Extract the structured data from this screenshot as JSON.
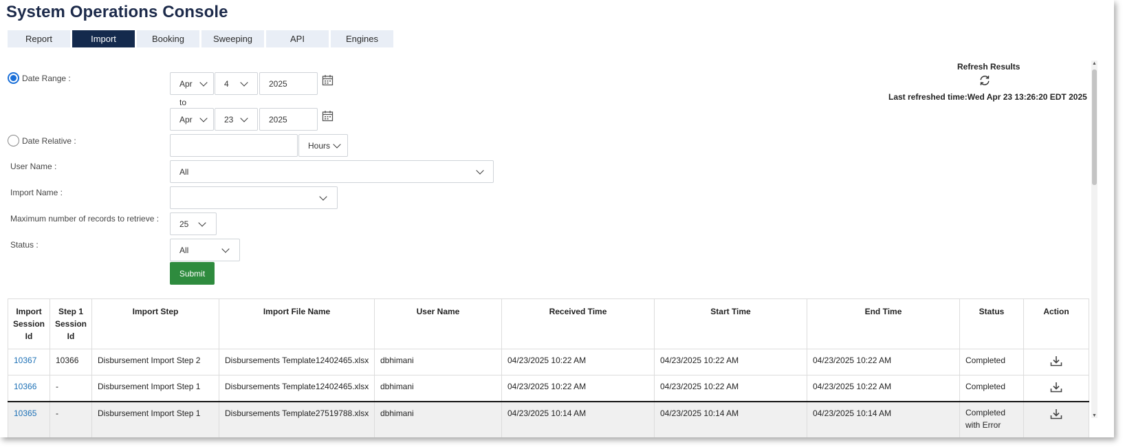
{
  "app": {
    "title": "System Operations Console"
  },
  "tabs": [
    {
      "label": "Report",
      "active": false
    },
    {
      "label": "Import",
      "active": true
    },
    {
      "label": "Booking",
      "active": false
    },
    {
      "label": "Sweeping",
      "active": false
    },
    {
      "label": "API",
      "active": false
    },
    {
      "label": "Engines",
      "active": false
    }
  ],
  "filters": {
    "date_range": {
      "label": "Date Range :",
      "selected": true,
      "from": {
        "month": "Apr",
        "day": "4",
        "year": "2025"
      },
      "to_label": "to",
      "to": {
        "month": "Apr",
        "day": "23",
        "year": "2025"
      }
    },
    "date_relative": {
      "label": "Date Relative :",
      "selected": false,
      "value": "",
      "unit": "Hours"
    },
    "user_name": {
      "label": "User Name :",
      "value": "All"
    },
    "import_name": {
      "label": "Import Name :",
      "value": ""
    },
    "max_records": {
      "label": "Maximum number of records to retrieve :",
      "value": "25"
    },
    "status": {
      "label": "Status :",
      "value": "All"
    },
    "submit_label": "Submit"
  },
  "refresh": {
    "title": "Refresh Results",
    "last_refreshed": "Last refreshed time:Wed Apr 23 13:26:20 EDT 2025"
  },
  "table": {
    "columns": [
      "Import Session Id",
      "Step 1 Session Id",
      "Import Step",
      "Import File Name",
      "User Name",
      "Received Time",
      "Start Time",
      "End Time",
      "Status",
      "Action"
    ],
    "rows": [
      {
        "session_id": "10367",
        "step1_id": "10366",
        "step": "Disbursement Import Step 2",
        "file": "Disbursements Template12402465.xlsx",
        "user": "dbhimani",
        "received": "04/23/2025 10:22 AM",
        "start": "04/23/2025 10:22 AM",
        "end": "04/23/2025 10:22 AM",
        "status": "Completed"
      },
      {
        "session_id": "10366",
        "step1_id": "-",
        "step": "Disbursement Import Step 1",
        "file": "Disbursements Template12402465.xlsx",
        "user": "dbhimani",
        "received": "04/23/2025 10:22 AM",
        "start": "04/23/2025 10:22 AM",
        "end": "04/23/2025 10:22 AM",
        "status": "Completed"
      },
      {
        "session_id": "10365",
        "step1_id": "-",
        "step": "Disbursement Import Step 1",
        "file": "Disbursements Template27519788.xlsx",
        "user": "dbhimani",
        "received": "04/23/2025 10:14 AM",
        "start": "04/23/2025 10:14 AM",
        "end": "04/23/2025 10:14 AM",
        "status": "Completed with Error"
      }
    ]
  },
  "icons": {
    "calendar": "calendar-icon",
    "refresh": "refresh-icon",
    "download": "download-icon",
    "chevron": "chevron-down-icon"
  }
}
